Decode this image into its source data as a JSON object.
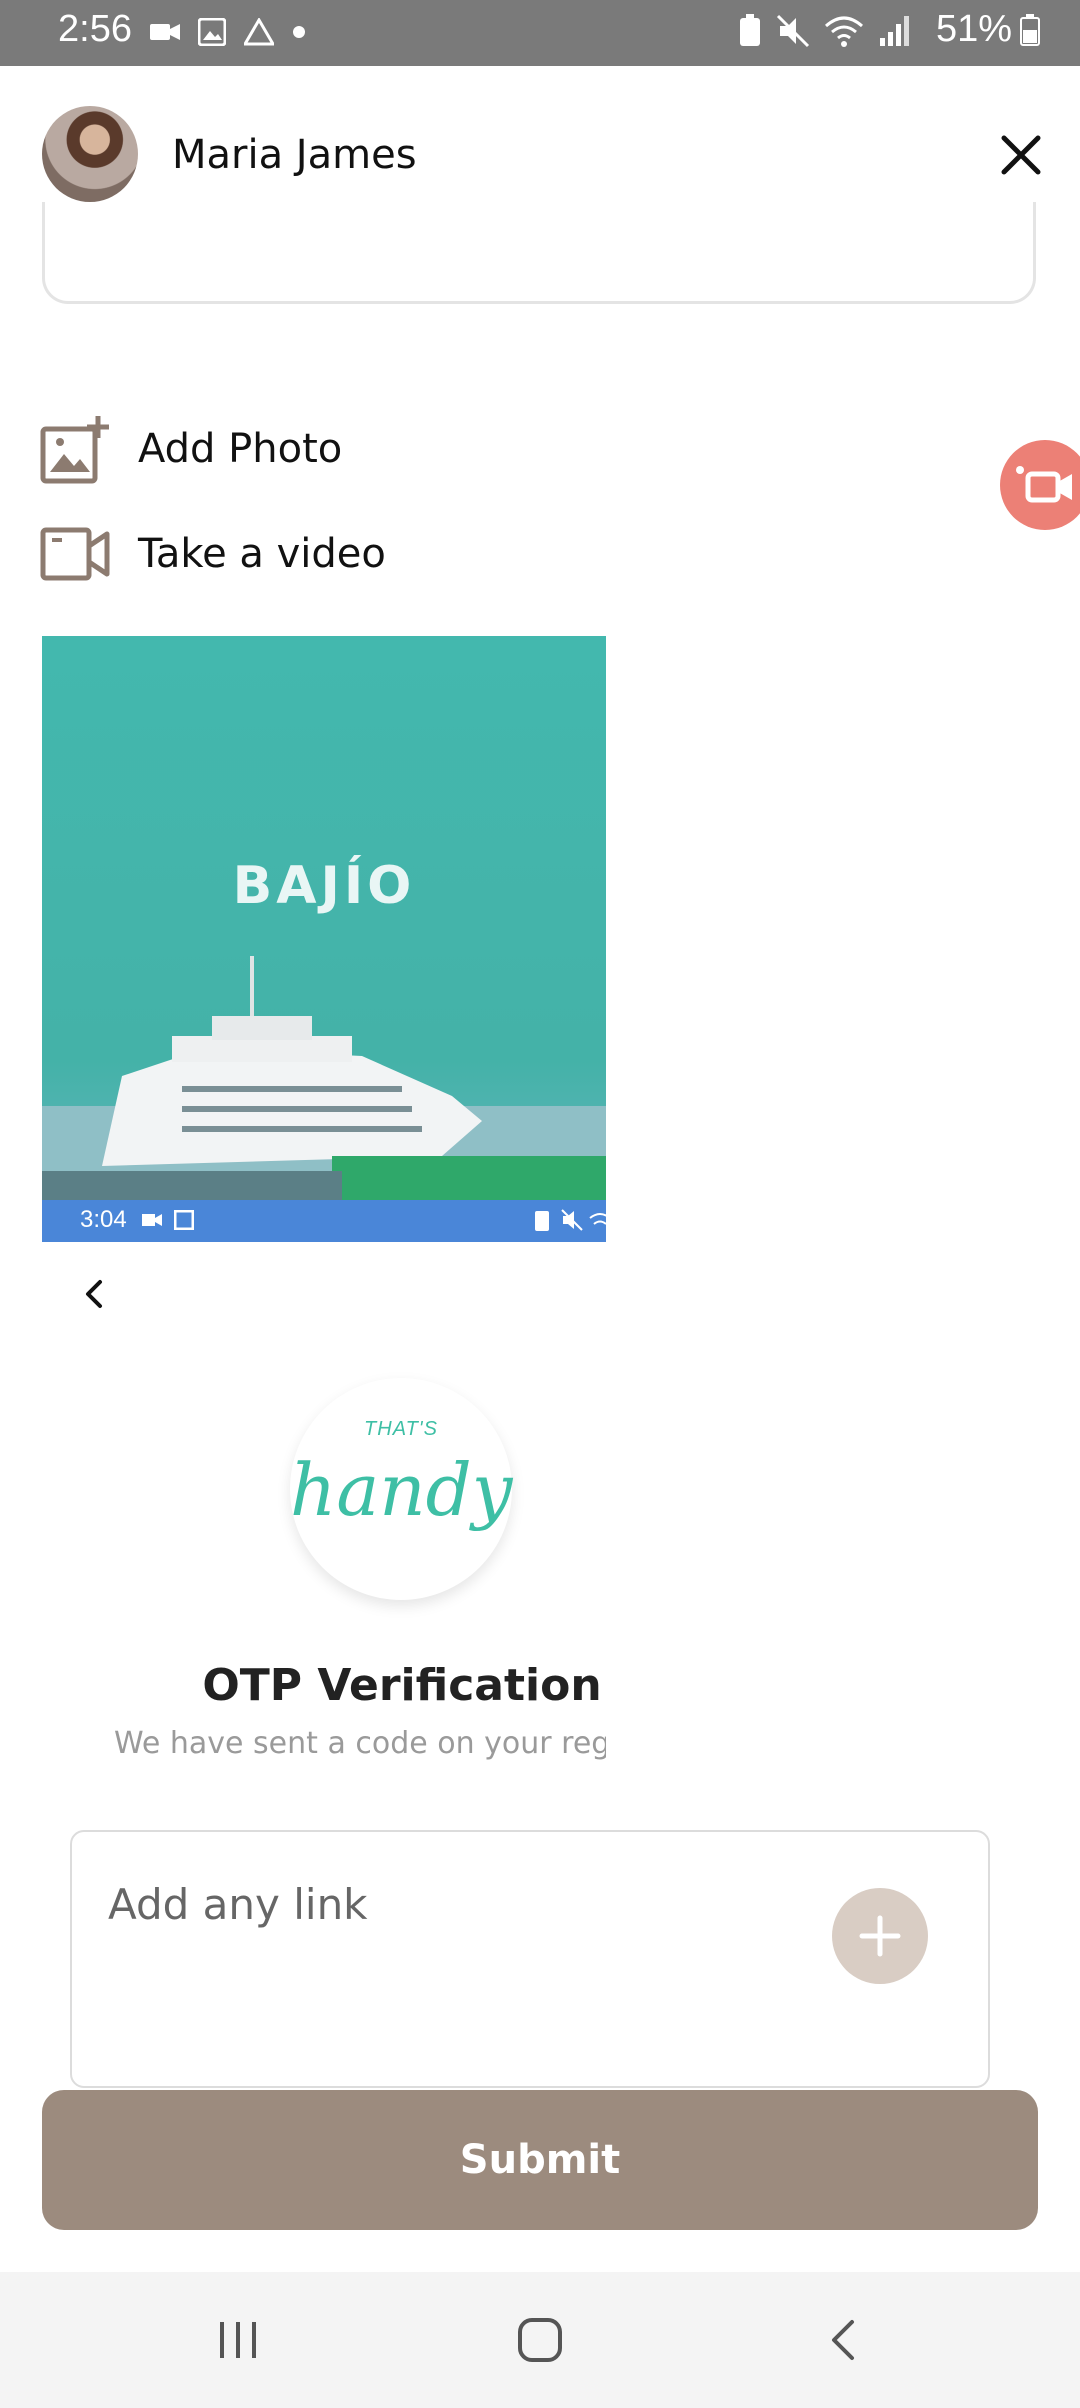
{
  "status_bar": {
    "time": "2:56",
    "battery_percent": "51%",
    "icons_left": [
      "video-icon",
      "image-icon",
      "drive-icon",
      "dot-icon"
    ],
    "icons_right": [
      "battery-saver-icon",
      "mute-icon",
      "wifi-icon",
      "signal-icon",
      "battery-icon"
    ]
  },
  "header": {
    "user_name": "Maria James",
    "close_icon": "close-icon"
  },
  "actions": {
    "add_photo_label": "Add Photo",
    "take_video_label": "Take a video"
  },
  "thumbnail": {
    "brand_text": "BAJÍO",
    "status_time": "3:04"
  },
  "otp_preview": {
    "logo_small": "THAT'S",
    "logo_main": "handy",
    "title": "OTP Verification",
    "subtitle": "We have sent a code on your regis"
  },
  "link_input": {
    "placeholder": "Add any link"
  },
  "submit_label": "Submit",
  "colors": {
    "accent_brown": "#9c8b7e",
    "fab_coral": "#ec8076",
    "teal": "#43b8ae"
  }
}
